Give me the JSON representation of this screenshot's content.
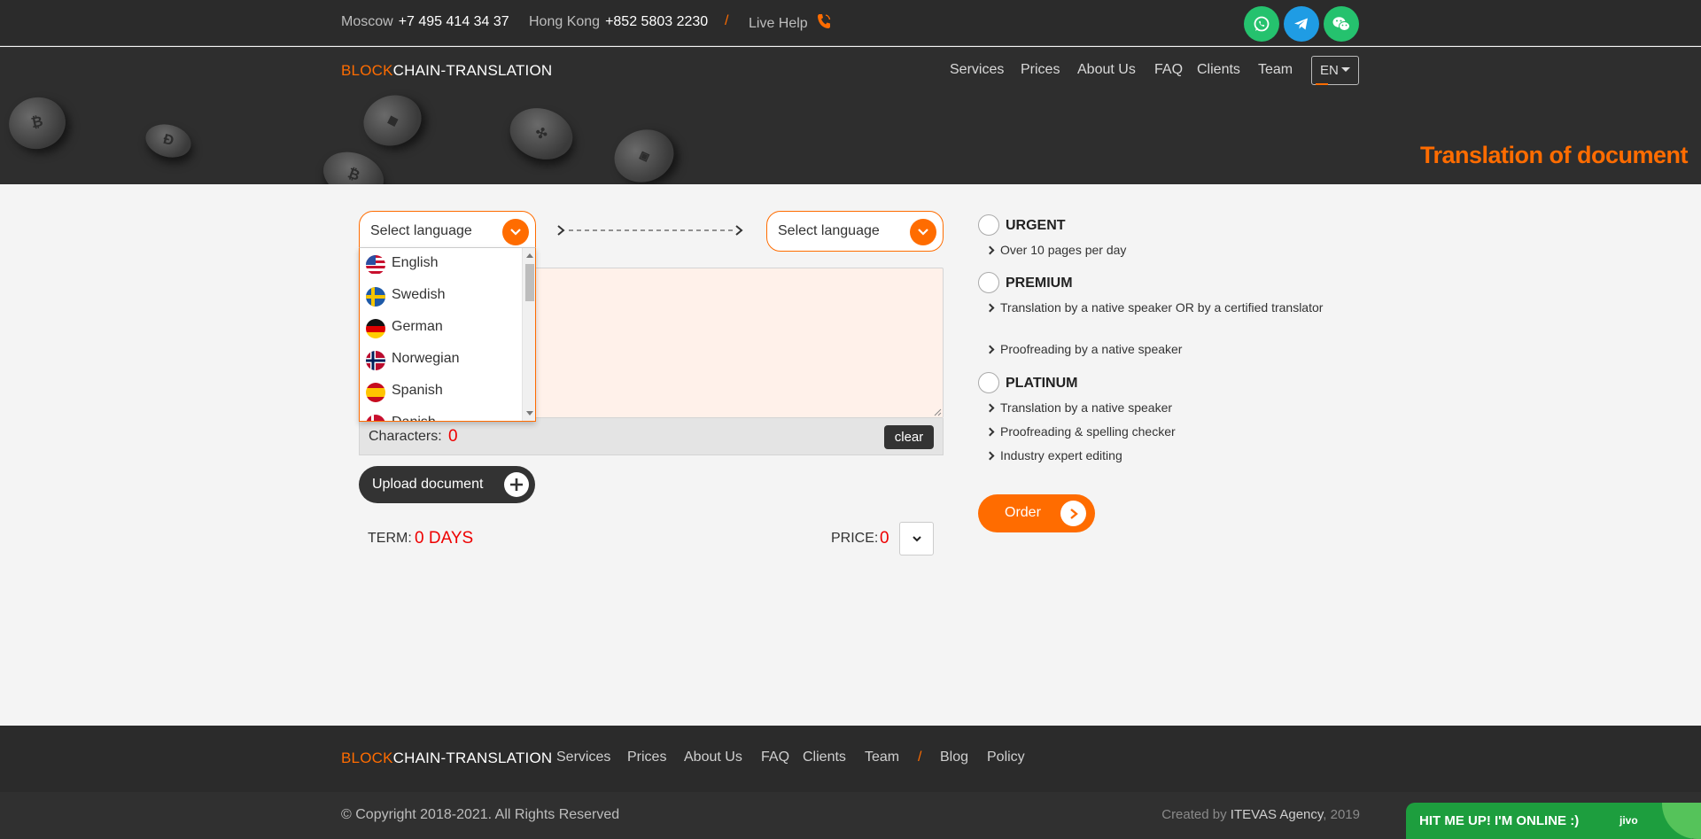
{
  "topbar": {
    "contacts": [
      {
        "city": "Moscow",
        "phone": "+7 495 414 34 37"
      },
      {
        "city": "Hong Kong",
        "phone": "+852 5803 2230"
      }
    ],
    "separator": "/",
    "live_help": "Live Help",
    "social": [
      {
        "name": "whatsapp-icon",
        "color": "#25c26e"
      },
      {
        "name": "telegram-icon",
        "color": "#1f9ce4"
      },
      {
        "name": "wechat-icon",
        "color": "#25c26e"
      }
    ]
  },
  "brand": {
    "accent": "BLOCK",
    "rest": "CHAIN-TRANSLATION",
    "accent_color": "#ff6c00"
  },
  "nav": {
    "items": [
      "Services",
      "Prices",
      "About Us",
      "FAQ",
      "Clients",
      "Team"
    ],
    "language": "EN"
  },
  "hero": {
    "title": "Translation of document"
  },
  "translator": {
    "source_placeholder": "Select language",
    "target_placeholder": "Select language",
    "languages": [
      "English",
      "Swedish",
      "German",
      "Norwegian",
      "Spanish",
      "Danish"
    ],
    "characters_label": "Characters:",
    "characters_value": "0",
    "clear_label": "clear",
    "upload_label": "Upload document",
    "term_label": "TERM:",
    "term_value": "0 DAYS",
    "price_label": "PRICE:",
    "price_value": "0"
  },
  "plans": [
    {
      "title": "URGENT",
      "features": [
        "Over 10 pages per day"
      ]
    },
    {
      "title": "PREMIUM",
      "features": [
        "Translation by a native speaker OR by a certified translator",
        "Proofreading by a native speaker"
      ]
    },
    {
      "title": "PLATINUM",
      "features": [
        "Translation by a native speaker",
        "Proofreading & spelling checker",
        "Industry expert editing"
      ]
    }
  ],
  "order_label": "Order",
  "footer": {
    "links": [
      "Services",
      "Prices",
      "About Us",
      "FAQ",
      "Clients",
      "Team"
    ],
    "separator": "/",
    "extra_links": [
      "Blog",
      "Policy"
    ],
    "copyright": "© Copyright 2018-2021. All Rights Reserved",
    "created_prefix": "Created by",
    "agency": "ITEVAS Agency",
    "created_year": ", 2019"
  },
  "chat_widget": {
    "message": "HIT ME UP! I'M ONLINE :)",
    "brand": "jivo"
  }
}
